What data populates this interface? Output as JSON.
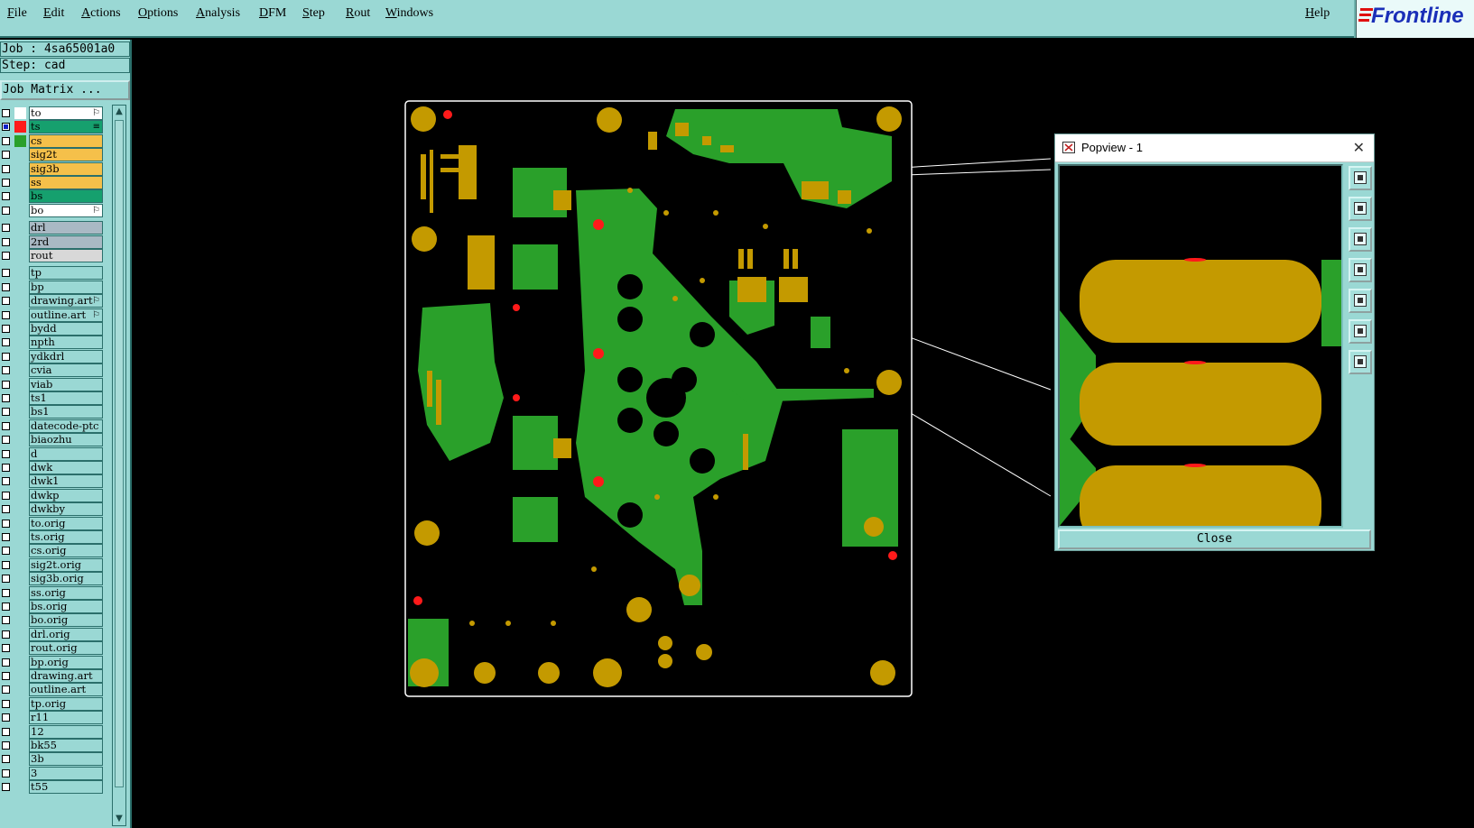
{
  "menu": {
    "items": [
      "File",
      "Edit",
      "Actions",
      "Options",
      "Analysis",
      "DFM",
      "Step",
      "Rout",
      "Windows"
    ],
    "help": "Help",
    "logo": "Frontline"
  },
  "job_info": {
    "job": "Job : 4sa65001a0",
    "step": "Step: cad",
    "matrix_button": "Job Matrix ..."
  },
  "layers": [
    {
      "name": "to",
      "color": "#ffffff",
      "bg": "#ffffff",
      "checked": false,
      "mark": "⚐"
    },
    {
      "name": "ts",
      "color": "#ff1a1a",
      "bg": "#16a06e",
      "checked": true,
      "mark": "≡"
    },
    {
      "name": "cs",
      "color": "#2aa02a",
      "bg": "#f5c04a",
      "checked": false,
      "mark": ""
    },
    {
      "name": "sig2t",
      "color": "#9ad8d4",
      "bg": "#f5c04a",
      "checked": false,
      "mark": ""
    },
    {
      "name": "sig3b",
      "color": "#9ad8d4",
      "bg": "#f5c04a",
      "checked": false,
      "mark": ""
    },
    {
      "name": "ss",
      "color": "#9ad8d4",
      "bg": "#f5c04a",
      "checked": false,
      "mark": ""
    },
    {
      "name": "bs",
      "color": "#9ad8d4",
      "bg": "#16a06e",
      "checked": false,
      "mark": ""
    },
    {
      "name": "bo",
      "color": "#9ad8d4",
      "bg": "#ffffff",
      "checked": false,
      "mark": "⚐"
    },
    {
      "name": "drl",
      "color": "#9ad8d4",
      "bg": "#a9b9c4",
      "checked": false,
      "mark": ""
    },
    {
      "name": "2rd",
      "color": "#9ad8d4",
      "bg": "#a9b9c4",
      "checked": false,
      "mark": ""
    },
    {
      "name": "rout",
      "color": "#9ad8d4",
      "bg": "#d8d8d8",
      "checked": false,
      "mark": ""
    },
    {
      "name": "tp",
      "color": "#9ad8d4",
      "bg": "#9ad8d4",
      "checked": false,
      "mark": ""
    },
    {
      "name": "bp",
      "color": "#9ad8d4",
      "bg": "#9ad8d4",
      "checked": false,
      "mark": ""
    },
    {
      "name": "drawing.art",
      "color": "#9ad8d4",
      "bg": "#9ad8d4",
      "checked": false,
      "mark": "⚐"
    },
    {
      "name": "outline.art",
      "color": "#9ad8d4",
      "bg": "#9ad8d4",
      "checked": false,
      "mark": "⚐"
    },
    {
      "name": "bydd",
      "color": "#9ad8d4",
      "bg": "#9ad8d4",
      "checked": false,
      "mark": ""
    },
    {
      "name": "npth",
      "color": "#9ad8d4",
      "bg": "#9ad8d4",
      "checked": false,
      "mark": ""
    },
    {
      "name": "ydkdrl",
      "color": "#9ad8d4",
      "bg": "#9ad8d4",
      "checked": false,
      "mark": ""
    },
    {
      "name": "cvia",
      "color": "#9ad8d4",
      "bg": "#9ad8d4",
      "checked": false,
      "mark": ""
    },
    {
      "name": "viab",
      "color": "#9ad8d4",
      "bg": "#9ad8d4",
      "checked": false,
      "mark": ""
    },
    {
      "name": "ts1",
      "color": "#9ad8d4",
      "bg": "#9ad8d4",
      "checked": false,
      "mark": ""
    },
    {
      "name": "bs1",
      "color": "#9ad8d4",
      "bg": "#9ad8d4",
      "checked": false,
      "mark": ""
    },
    {
      "name": "datecode-ptc",
      "color": "#9ad8d4",
      "bg": "#9ad8d4",
      "checked": false,
      "mark": ""
    },
    {
      "name": "biaozhu",
      "color": "#9ad8d4",
      "bg": "#9ad8d4",
      "checked": false,
      "mark": ""
    },
    {
      "name": "d",
      "color": "#9ad8d4",
      "bg": "#9ad8d4",
      "checked": false,
      "mark": ""
    },
    {
      "name": "dwk",
      "color": "#9ad8d4",
      "bg": "#9ad8d4",
      "checked": false,
      "mark": ""
    },
    {
      "name": "dwk1",
      "color": "#9ad8d4",
      "bg": "#9ad8d4",
      "checked": false,
      "mark": ""
    },
    {
      "name": "dwkp",
      "color": "#9ad8d4",
      "bg": "#9ad8d4",
      "checked": false,
      "mark": ""
    },
    {
      "name": "dwkby",
      "color": "#9ad8d4",
      "bg": "#9ad8d4",
      "checked": false,
      "mark": ""
    },
    {
      "name": "to.orig",
      "color": "#9ad8d4",
      "bg": "#9ad8d4",
      "checked": false,
      "mark": ""
    },
    {
      "name": "ts.orig",
      "color": "#9ad8d4",
      "bg": "#9ad8d4",
      "checked": false,
      "mark": ""
    },
    {
      "name": "cs.orig",
      "color": "#9ad8d4",
      "bg": "#9ad8d4",
      "checked": false,
      "mark": ""
    },
    {
      "name": "sig2t.orig",
      "color": "#9ad8d4",
      "bg": "#9ad8d4",
      "checked": false,
      "mark": ""
    },
    {
      "name": "sig3b.orig",
      "color": "#9ad8d4",
      "bg": "#9ad8d4",
      "checked": false,
      "mark": ""
    },
    {
      "name": "ss.orig",
      "color": "#9ad8d4",
      "bg": "#9ad8d4",
      "checked": false,
      "mark": ""
    },
    {
      "name": "bs.orig",
      "color": "#9ad8d4",
      "bg": "#9ad8d4",
      "checked": false,
      "mark": ""
    },
    {
      "name": "bo.orig",
      "color": "#9ad8d4",
      "bg": "#9ad8d4",
      "checked": false,
      "mark": ""
    },
    {
      "name": "drl.orig",
      "color": "#9ad8d4",
      "bg": "#9ad8d4",
      "checked": false,
      "mark": ""
    },
    {
      "name": "rout.orig",
      "color": "#9ad8d4",
      "bg": "#9ad8d4",
      "checked": false,
      "mark": ""
    },
    {
      "name": "bp.orig",
      "color": "#9ad8d4",
      "bg": "#9ad8d4",
      "checked": false,
      "mark": ""
    },
    {
      "name": "drawing.art",
      "color": "#9ad8d4",
      "bg": "#9ad8d4",
      "checked": false,
      "mark": ""
    },
    {
      "name": "outline.art",
      "color": "#9ad8d4",
      "bg": "#9ad8d4",
      "checked": false,
      "mark": ""
    },
    {
      "name": "tp.orig",
      "color": "#9ad8d4",
      "bg": "#9ad8d4",
      "checked": false,
      "mark": ""
    },
    {
      "name": "r11",
      "color": "#9ad8d4",
      "bg": "#9ad8d4",
      "checked": false,
      "mark": ""
    },
    {
      "name": "12",
      "color": "#9ad8d4",
      "bg": "#9ad8d4",
      "checked": false,
      "mark": ""
    },
    {
      "name": "bk55",
      "color": "#9ad8d4",
      "bg": "#9ad8d4",
      "checked": false,
      "mark": ""
    },
    {
      "name": "3b",
      "color": "#9ad8d4",
      "bg": "#9ad8d4",
      "checked": false,
      "mark": ""
    },
    {
      "name": "3",
      "color": "#9ad8d4",
      "bg": "#9ad8d4",
      "checked": false,
      "mark": ""
    },
    {
      "name": "t55",
      "color": "#9ad8d4",
      "bg": "#9ad8d4",
      "checked": false,
      "mark": ""
    }
  ],
  "popview": {
    "title": "Popview - 1",
    "close_button": "Close",
    "tools": [
      "zoom-fit-icon",
      "pan-up-icon",
      "pan-down-icon",
      "pan-left-icon",
      "pan-right-icon",
      "zoom-in-icon",
      "zoom-out-icon"
    ]
  },
  "colors": {
    "ui_bg": "#9ad8d4",
    "copper": "#c49a00",
    "trace": "#2aa02a",
    "drill": "#ff1a1a",
    "board_outline": "#ffffff"
  }
}
